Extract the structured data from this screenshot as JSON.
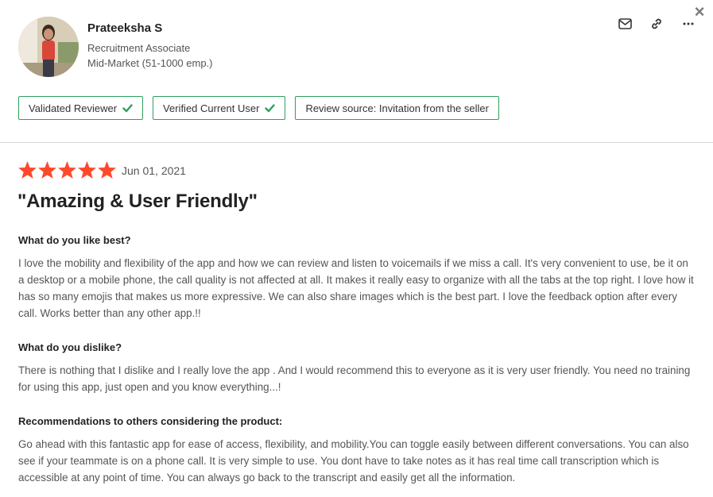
{
  "reviewer": {
    "name": "Prateeksha S",
    "role": "Recruitment Associate",
    "segment": "Mid-Market (51-1000 emp.)"
  },
  "actions": [
    "mail-icon",
    "link-icon",
    "more-icon"
  ],
  "close_icon": "×",
  "badges": [
    {
      "label": "Validated Reviewer",
      "icon": "check-icon"
    },
    {
      "label": "Verified Current User",
      "icon": "check-icon"
    },
    {
      "label": "Review source: Invitation from the seller",
      "icon": ""
    }
  ],
  "review": {
    "rating": 5,
    "max_rating": 5,
    "date": "Jun 01, 2021",
    "title": "\"Amazing & User Friendly\"",
    "star_color": "#ff492c",
    "sections": [
      {
        "heading": "What do you like best?",
        "body": "I love the mobility and flexibility of the app and how we can review and listen to voicemails if we miss a call. It's very convenient to use, be it on a desktop or a mobile phone, the call quality is not affected at all. It makes it really easy to organize with all the tabs at the top right. I love how it has so many emojis that makes us more expressive. We can also share images which is the best part. I love the feedback option after every call. Works better than any other app.!!"
      },
      {
        "heading": "What do you dislike?",
        "body": "There is nothing that I dislike and I really love the app . And I would recommend this to everyone as it is very user friendly. You need no training for using this app, just open and you know everything...!"
      },
      {
        "heading": "Recommendations to others considering the product:",
        "body": "Go ahead with this fantastic app for ease of access, flexibility, and mobility.You can toggle easily between different conversations. You can also see if your teammate is on a phone call. It is very simple to use. You dont have to take notes as it has real time call transcription which is accessible at any point of time. You can always go back to the transcript and easily get all the information."
      }
    ]
  }
}
